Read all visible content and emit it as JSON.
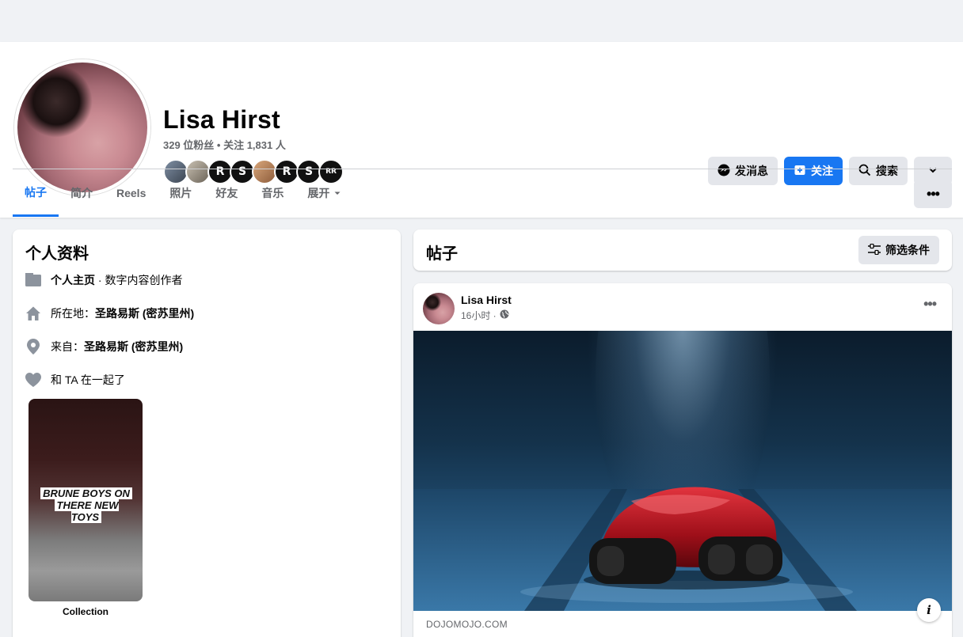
{
  "profile": {
    "name": "Lisa Hirst",
    "stats": "329 位粉丝 • 关注 1,831 人",
    "friend_avatars": [
      "friend-1",
      "friend-2",
      "friend-3",
      "friend-4",
      "friend-5",
      "friend-6",
      "friend-7",
      "friend-8"
    ]
  },
  "actions": {
    "message": "发消息",
    "follow": "关注",
    "search": "搜索"
  },
  "tabs": [
    {
      "label": "帖子",
      "active": true
    },
    {
      "label": "简介"
    },
    {
      "label": "Reels"
    },
    {
      "label": "照片"
    },
    {
      "label": "好友"
    },
    {
      "label": "音乐"
    },
    {
      "label": "展开"
    }
  ],
  "intro": {
    "title": "个人资料",
    "page_prefix": "个人主页",
    "page_suffix": " · 数字内容创作者",
    "lives_prefix": "所在地：",
    "lives_value": "圣路易斯 (密苏里州)",
    "from_prefix": "来自：",
    "from_value": "圣路易斯 (密苏里州)",
    "relationship": "和 TA 在一起了",
    "reel_line1": "BRUNE BOYS ON",
    "reel_line2": "THERE NEW TOYS",
    "reel_caption": "Collection"
  },
  "posts": {
    "title": "帖子",
    "filter": "筛选条件"
  },
  "post": {
    "author": "Lisa Hirst",
    "time": "16小时 ·",
    "domain": "DOJOMOJO.COM",
    "info_icon": "i"
  },
  "colors": {
    "accent": "#1877f2",
    "background": "#f0f2f5",
    "secondary_text": "#65676b"
  }
}
